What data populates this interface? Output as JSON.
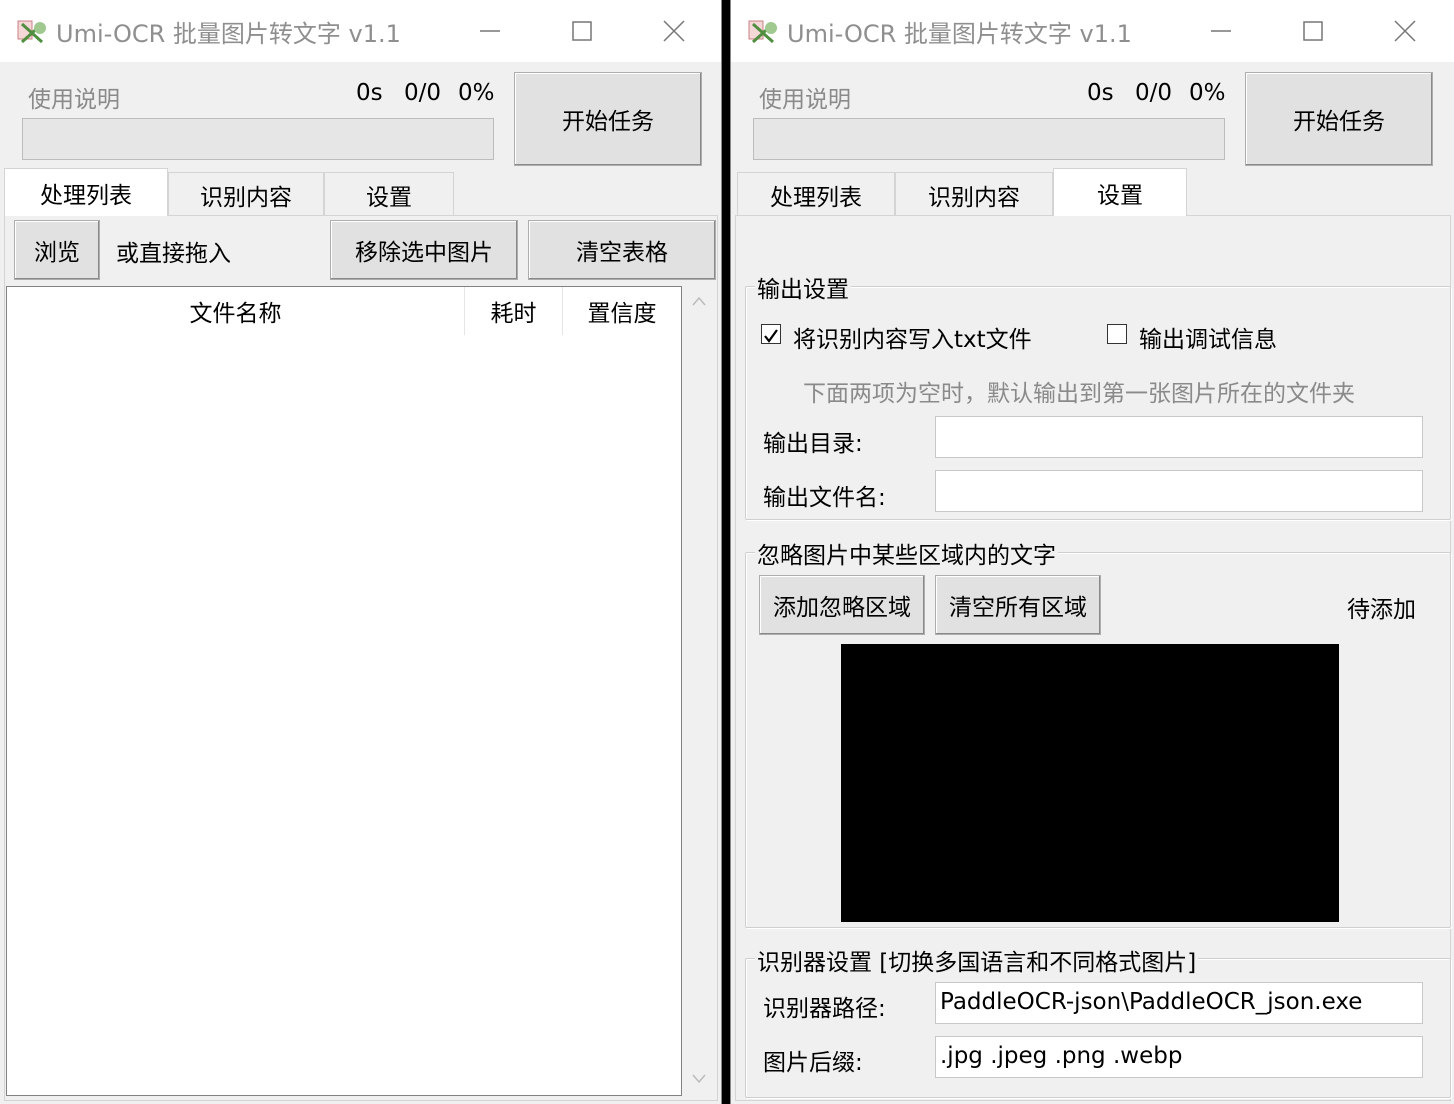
{
  "left_window": {
    "title": "Umi-OCR 批量图片转文字 v1.1",
    "help_link": "使用说明",
    "elapsed": "0s",
    "count": "0/0",
    "percent": "0%",
    "progress": 0,
    "start_button": "开始任务",
    "tabs": [
      "处理列表",
      "识别内容",
      "设置"
    ],
    "active_tab": 0,
    "browse_button": "浏览",
    "drag_hint": "或直接拖入",
    "remove_button": "移除选中图片",
    "clear_button": "清空表格",
    "table_headers": [
      "文件名称",
      "耗时",
      "置信度"
    ]
  },
  "right_window": {
    "title": "Umi-OCR 批量图片转文字 v1.1",
    "help_link": "使用说明",
    "elapsed": "0s",
    "count": "0/0",
    "percent": "0%",
    "progress": 0,
    "start_button": "开始任务",
    "tabs": [
      "处理列表",
      "识别内容",
      "设置"
    ],
    "active_tab": 2,
    "output_settings": {
      "legend": "输出设置",
      "write_txt_label": "将识别内容写入txt文件",
      "write_txt_checked": true,
      "debug_label": "输出调试信息",
      "debug_checked": false,
      "hint": "下面两项为空时，默认输出到第一张图片所在的文件夹",
      "dir_label": "输出目录:",
      "dir_value": "",
      "filename_label": "输出文件名:",
      "filename_value": ""
    },
    "ignore_area": {
      "legend": "忽略图片中某些区域内的文字",
      "add_button": "添加忽略区域",
      "clear_button": "清空所有区域",
      "status": "待添加",
      "preview_color": "#000000"
    },
    "recognizer": {
      "legend": "识别器设置 [切换多国语言和不同格式图片]",
      "path_label": "识别器路径:",
      "path_value": "PaddleOCR-json\\PaddleOCR_json.exe",
      "ext_label": "图片后缀:",
      "ext_value": ".jpg .jpeg .png .webp"
    }
  }
}
